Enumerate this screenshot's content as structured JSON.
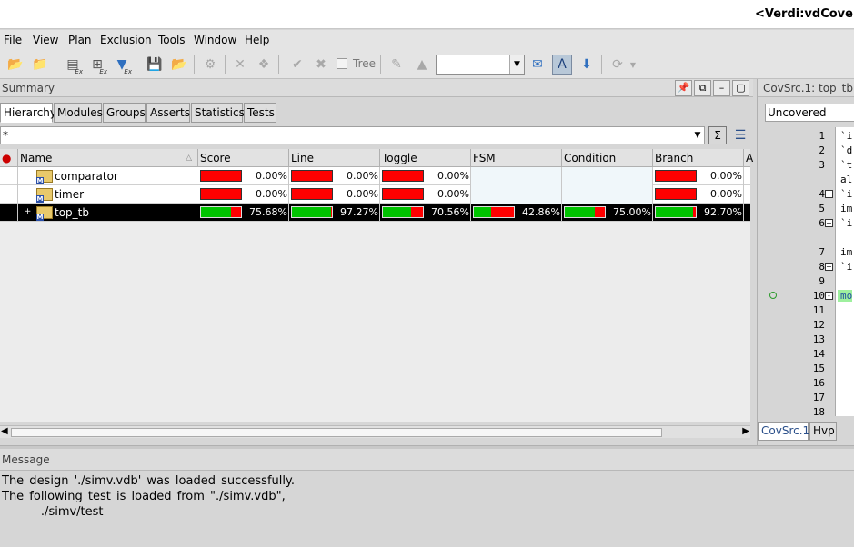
{
  "window": {
    "title": "<Verdi:vdCovera"
  },
  "menu": [
    "File",
    "View",
    "Plan",
    "Exclusion",
    "Tools",
    "Window",
    "Help"
  ],
  "toolbar": {
    "tree_label": "Tree",
    "icons": [
      "open-folder-icon",
      "open-icon",
      "remove-ex-icon",
      "add-ex-icon",
      "filter-ex-icon",
      "save-ex-icon",
      "load-ex-icon",
      "recalc-icon",
      "cut-icon",
      "merge-icon",
      "check-icon",
      "cancel-icon",
      "tree-checkbox",
      "edit-icon",
      "eraser-icon",
      "chat-icon",
      "highlight-icon",
      "apply-icon",
      "refresh-icon"
    ],
    "combo_value": ""
  },
  "summary": {
    "title": "Summary",
    "tabs": [
      "Hierarchy",
      "Modules",
      "Groups",
      "Asserts",
      "Statistics",
      "Tests"
    ],
    "active_tab": "Hierarchy",
    "filter_value": "*",
    "columns": [
      "Name",
      "Score",
      "Line",
      "Toggle",
      "FSM",
      "Condition",
      "Branch"
    ],
    "rows": [
      {
        "name": "comparator",
        "score": "0.00%",
        "line": "0.00%",
        "toggle": "0.00%",
        "fsm": "",
        "condition": "",
        "branch": "0.00%",
        "score_v": 0,
        "line_v": 0,
        "toggle_v": 0,
        "fsm_v": null,
        "condition_v": null,
        "branch_v": 0
      },
      {
        "name": "timer",
        "score": "0.00%",
        "line": "0.00%",
        "toggle": "0.00%",
        "fsm": "",
        "condition": "",
        "branch": "0.00%",
        "score_v": 0,
        "line_v": 0,
        "toggle_v": 0,
        "fsm_v": null,
        "condition_v": null,
        "branch_v": 0
      },
      {
        "name": "top_tb",
        "score": "75.68%",
        "line": "97.27%",
        "toggle": "70.56%",
        "fsm": "42.86%",
        "condition": "75.00%",
        "branch": "92.70%",
        "score_v": 75.68,
        "line_v": 97.27,
        "toggle_v": 70.56,
        "fsm_v": 42.86,
        "condition_v": 75.0,
        "branch_v": 92.7,
        "expandable": true,
        "selected": true
      }
    ]
  },
  "covsrc": {
    "title": "CovSrc.1: top_tb",
    "filter": "Uncovered",
    "lines": [
      {
        "n": "1",
        "text": "`i"
      },
      {
        "n": "2",
        "text": "`d"
      },
      {
        "n": "3",
        "text": "`t"
      },
      {
        "n": "",
        "text": "al"
      },
      {
        "n": "4",
        "text": "`i",
        "fold": "+"
      },
      {
        "n": "5",
        "text": "im"
      },
      {
        "n": "6",
        "text": "`i",
        "fold": "+"
      },
      {
        "n": "",
        "text": ""
      },
      {
        "n": "7",
        "text": "im"
      },
      {
        "n": "8",
        "text": "`i",
        "fold": "+"
      },
      {
        "n": "9",
        "text": ""
      },
      {
        "n": "10",
        "text": "mo",
        "fold": "-",
        "highlight": true,
        "marker": true
      },
      {
        "n": "11",
        "text": ""
      },
      {
        "n": "12",
        "text": ""
      },
      {
        "n": "13",
        "text": ""
      },
      {
        "n": "14",
        "text": ""
      },
      {
        "n": "15",
        "text": ""
      },
      {
        "n": "16",
        "text": ""
      },
      {
        "n": "17",
        "text": ""
      },
      {
        "n": "18",
        "text": ""
      }
    ],
    "tabs": [
      "CovSrc.1",
      "Hvp"
    ]
  },
  "message": {
    "title": "Message",
    "lines": [
      "The design './simv.vdb' was loaded successfully.",
      "The following test is loaded from \"./simv.vdb\",",
      "       ./simv/test"
    ]
  }
}
